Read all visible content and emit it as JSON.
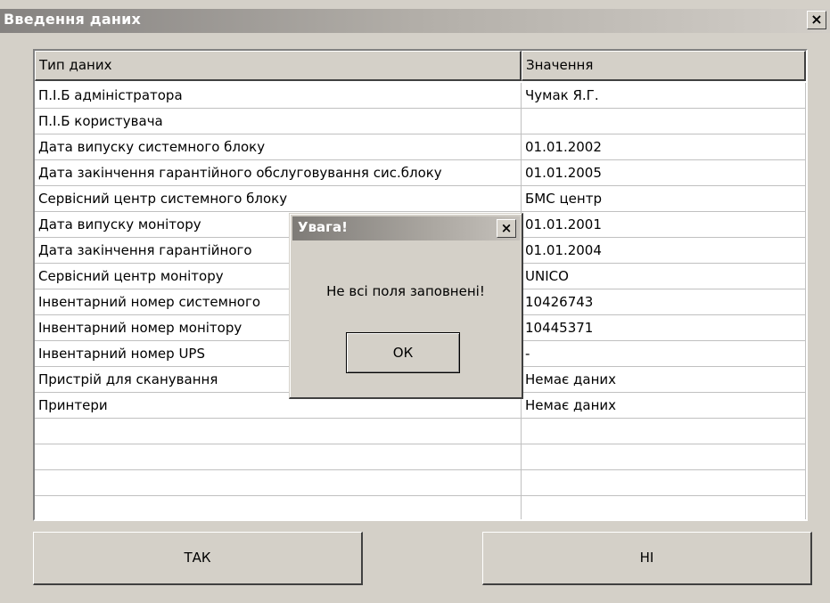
{
  "window": {
    "title": "Введення даних",
    "close_glyph": "×"
  },
  "grid": {
    "columns": [
      "Тип даних",
      "Значення"
    ],
    "rows": [
      {
        "type": "П.І.Б адміністратора",
        "value": "Чумак Я.Г."
      },
      {
        "type": "П.І.Б користувача",
        "value": ""
      },
      {
        "type": "Дата випуску системного блоку",
        "value": "01.01.2002"
      },
      {
        "type": "Дата закінчення гарантійного обслуговування сис.блоку",
        "value": "01.01.2005"
      },
      {
        "type": "Сервісний центр системного блоку",
        "value": "БМС центр"
      },
      {
        "type": "Дата випуску монітору",
        "value": "01.01.2001"
      },
      {
        "type": "Дата закінчення гарантійного",
        "value": "01.01.2004"
      },
      {
        "type": "Сервісний центр монітору",
        "value": "UNICO"
      },
      {
        "type": "Інвентарний номер системного",
        "value": "10426743"
      },
      {
        "type": "Інвентарний номер монітору",
        "value": "10445371"
      },
      {
        "type": "Інвентарний номер UPS",
        "value": "-"
      },
      {
        "type": "Пристрій для сканування",
        "value": "Немає даних"
      },
      {
        "type": "Принтери",
        "value": "Немає даних"
      },
      {
        "type": "",
        "value": ""
      },
      {
        "type": "",
        "value": ""
      },
      {
        "type": "",
        "value": ""
      },
      {
        "type": "",
        "value": ""
      }
    ]
  },
  "buttons": {
    "yes": "ТАК",
    "no": "НІ"
  },
  "dialog": {
    "title": "Увага!",
    "close_glyph": "×",
    "message": "Не всі поля заповнені!",
    "ok": "ОК"
  }
}
